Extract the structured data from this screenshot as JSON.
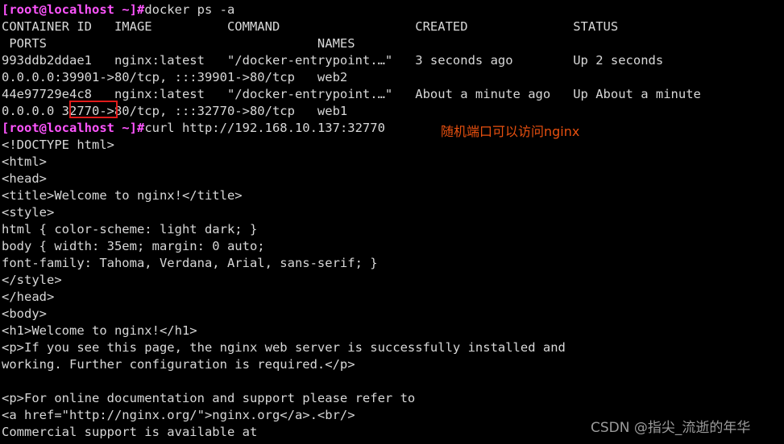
{
  "terminal": {
    "background_color": "#000000",
    "foreground_color": "#d8d8d8",
    "prompt_color": "#ff55ff",
    "prompt_text": "[root@localhost ~]#",
    "lines": [
      {
        "type": "prompt",
        "prompt": "[root@localhost ~]#",
        "command": "docker ps -a"
      },
      {
        "type": "output",
        "text": "CONTAINER ID   IMAGE          COMMAND                  CREATED              STATUS"
      },
      {
        "type": "output",
        "text": " PORTS                                    NAMES"
      },
      {
        "type": "output",
        "text": "993ddb2ddae1   nginx:latest   \"/docker-entrypoint.…\"   3 seconds ago        Up 2 seconds"
      },
      {
        "type": "output",
        "text": "0.0.0.0:39901->80/tcp, :::39901->80/tcp   web2"
      },
      {
        "type": "output",
        "text": "44e97729e4c8   nginx:latest   \"/docker-entrypoint.…\"   About a minute ago   Up About a minute"
      },
      {
        "type": "output",
        "text": "0.0.0.0 32770->80/tcp, :::32770->80/tcp   web1"
      },
      {
        "type": "prompt",
        "prompt": "[root@localhost ~]#",
        "command": "curl http://192.168.10.137:32770"
      },
      {
        "type": "output",
        "text": "<!DOCTYPE html>"
      },
      {
        "type": "output",
        "text": "<html>"
      },
      {
        "type": "output",
        "text": "<head>"
      },
      {
        "type": "output",
        "text": "<title>Welcome to nginx!</title>"
      },
      {
        "type": "output",
        "text": "<style>"
      },
      {
        "type": "output",
        "text": "html { color-scheme: light dark; }"
      },
      {
        "type": "output",
        "text": "body { width: 35em; margin: 0 auto;"
      },
      {
        "type": "output",
        "text": "font-family: Tahoma, Verdana, Arial, sans-serif; }"
      },
      {
        "type": "output",
        "text": "</style>"
      },
      {
        "type": "output",
        "text": "</head>"
      },
      {
        "type": "output",
        "text": "<body>"
      },
      {
        "type": "output",
        "text": "<h1>Welcome to nginx!</h1>"
      },
      {
        "type": "output",
        "text": "<p>If you see this page, the nginx web server is successfully installed and"
      },
      {
        "type": "output",
        "text": "working. Further configuration is required.</p>"
      },
      {
        "type": "output",
        "text": ""
      },
      {
        "type": "output",
        "text": "<p>For online documentation and support please refer to"
      },
      {
        "type": "output",
        "text": "<a href=\"http://nginx.org/\">nginx.org</a>.<br/>"
      },
      {
        "type": "output",
        "text": "Commercial support is available at"
      }
    ]
  },
  "docker_ps_table": {
    "headers": [
      "CONTAINER ID",
      "IMAGE",
      "COMMAND",
      "CREATED",
      "STATUS",
      "PORTS",
      "NAMES"
    ],
    "rows": [
      {
        "container_id": "993ddb2ddae1",
        "image": "nginx:latest",
        "command": "\"/docker-entrypoint.…\"",
        "created": "3 seconds ago",
        "status": "Up 2 seconds",
        "ports": "0.0.0.0:39901->80/tcp, :::39901->80/tcp",
        "names": "web2"
      },
      {
        "container_id": "44e97729e4c8",
        "image": "nginx:latest",
        "command": "\"/docker-entrypoint.…\"",
        "created": "About a minute ago",
        "status": "Up About a minute",
        "ports": "0.0.0.0 32770->80/tcp, :::32770->80/tcp",
        "names": "web1"
      }
    ]
  },
  "highlight": {
    "value": "32770",
    "color": "#e01b1b"
  },
  "annotation": {
    "text": "随机端口可以访问nginx",
    "color": "#e8500f"
  },
  "watermark": {
    "text": "CSDN @指尖_流逝的年华",
    "color": "#9b9b9b"
  }
}
